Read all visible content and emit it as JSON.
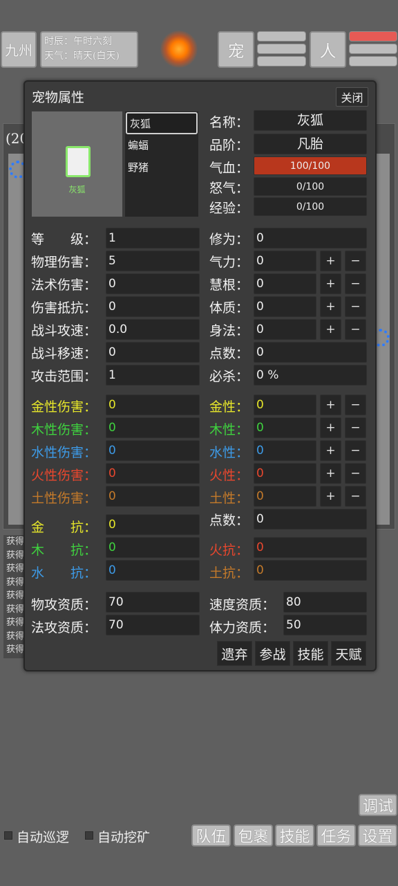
{
  "topbar": {
    "region": "九州",
    "time_line": "时辰：午时六刻",
    "weather_line": "天气：晴天(白天)",
    "pet_button": "宠",
    "person_button": "人"
  },
  "background": {
    "count_fragment": "(20",
    "log_lines": [
      "获得",
      "获得",
      "获得",
      "获得",
      "获得",
      "获得",
      "获得",
      "获得",
      "获得"
    ]
  },
  "dialog": {
    "title": "宠物属性",
    "close": "关闭",
    "preview_name": "灰狐",
    "pets": [
      "灰狐",
      "蝙蝠",
      "野猪"
    ],
    "info": {
      "name_label": "名称：",
      "name_value": "灰狐",
      "rank_label": "品阶：",
      "rank_value": "凡胎",
      "hp_label": "气血：",
      "hp_value": "100/100",
      "rage_label": "怒气：",
      "rage_value": "0/100",
      "exp_label": "经验：",
      "exp_value": "0/100"
    },
    "left_stats": [
      {
        "label": "等　　级：",
        "value": "1"
      },
      {
        "label": "物理伤害：",
        "value": "5"
      },
      {
        "label": "法术伤害：",
        "value": "0"
      },
      {
        "label": "伤害抵抗：",
        "value": "0"
      },
      {
        "label": "战斗攻速：",
        "value": "0.0"
      },
      {
        "label": "战斗移速：",
        "value": "0"
      },
      {
        "label": "攻击范围：",
        "value": "1"
      }
    ],
    "right_stats": [
      {
        "label": "修为：",
        "value": "0"
      },
      {
        "label": "气力：",
        "value": "0"
      },
      {
        "label": "慧根：",
        "value": "0"
      },
      {
        "label": "体质：",
        "value": "0"
      },
      {
        "label": "身法：",
        "value": "0"
      },
      {
        "label": "点数：",
        "value": "0"
      },
      {
        "label": "必杀：",
        "value": "0 %"
      }
    ],
    "element_damage": [
      {
        "label": "金性伤害：",
        "value": "0",
        "color": "#e6e62a"
      },
      {
        "label": "木性伤害：",
        "value": "0",
        "color": "#3fd23f"
      },
      {
        "label": "水性伤害：",
        "value": "0",
        "color": "#3d9be8"
      },
      {
        "label": "火性伤害：",
        "value": "0",
        "color": "#e8472e"
      },
      {
        "label": "土性伤害：",
        "value": "0",
        "color": "#c47a2a"
      }
    ],
    "element_attr": [
      {
        "label": "金性：",
        "value": "0",
        "color": "#e6e62a"
      },
      {
        "label": "木性：",
        "value": "0",
        "color": "#3fd23f"
      },
      {
        "label": "水性：",
        "value": "0",
        "color": "#3d9be8"
      },
      {
        "label": "火性：",
        "value": "0",
        "color": "#e8472e"
      },
      {
        "label": "土性：",
        "value": "0",
        "color": "#c47a2a"
      }
    ],
    "element_points": {
      "label": "点数：",
      "value": "0"
    },
    "resist_left": [
      {
        "label": "金　　抗：",
        "value": "0",
        "color": "#e6e62a"
      },
      {
        "label": "木　　抗：",
        "value": "0",
        "color": "#3fd23f"
      },
      {
        "label": "水　　抗：",
        "value": "0",
        "color": "#3d9be8"
      }
    ],
    "resist_right": [
      {
        "label": "火抗：",
        "value": "0",
        "color": "#e8472e"
      },
      {
        "label": "土抗：",
        "value": "0",
        "color": "#c47a2a"
      }
    ],
    "aptitude": {
      "phys_label": "物攻资质：",
      "phys_value": "70",
      "magic_label": "法攻资质：",
      "magic_value": "70",
      "speed_label": "速度资质：",
      "speed_value": "80",
      "stamina_label": "体力资质：",
      "stamina_value": "50"
    },
    "plus": "+",
    "minus": "−",
    "actions": [
      "遗弃",
      "参战",
      "技能",
      "天赋"
    ]
  },
  "bottom": {
    "auto_patrol": "自动巡逻",
    "auto_mine": "自动挖矿",
    "debug": "调试",
    "buttons": [
      "队伍",
      "包裹",
      "技能",
      "任务",
      "设置"
    ]
  }
}
